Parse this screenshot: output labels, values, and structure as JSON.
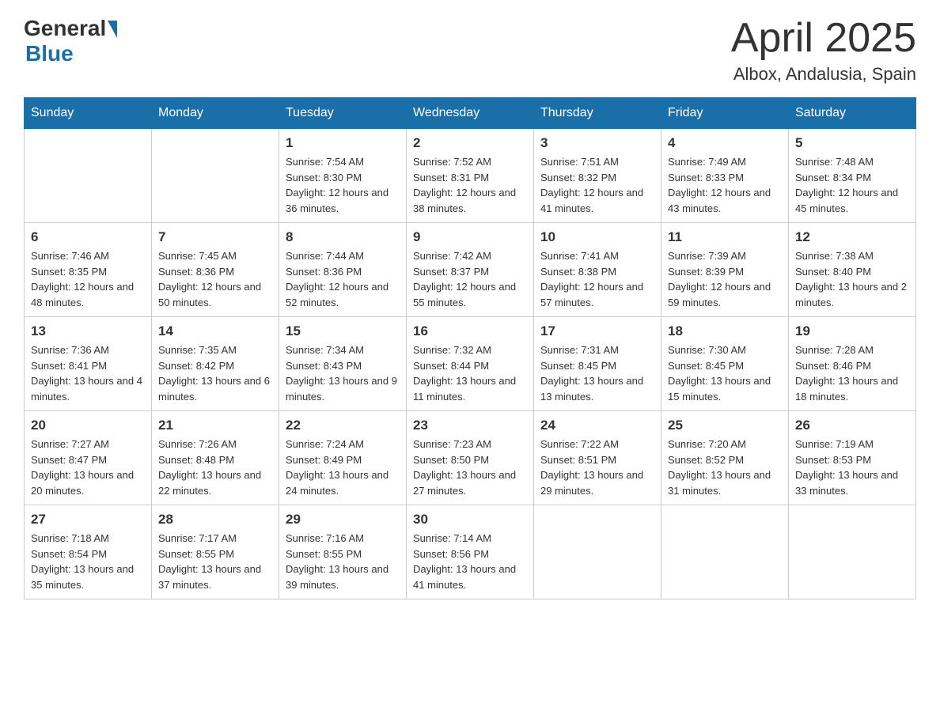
{
  "header": {
    "logo_general": "General",
    "logo_blue": "Blue",
    "title": "April 2025",
    "subtitle": "Albox, Andalusia, Spain"
  },
  "calendar": {
    "days_of_week": [
      "Sunday",
      "Monday",
      "Tuesday",
      "Wednesday",
      "Thursday",
      "Friday",
      "Saturday"
    ],
    "weeks": [
      [
        {
          "day": "",
          "sunrise": "",
          "sunset": "",
          "daylight": ""
        },
        {
          "day": "",
          "sunrise": "",
          "sunset": "",
          "daylight": ""
        },
        {
          "day": "1",
          "sunrise": "Sunrise: 7:54 AM",
          "sunset": "Sunset: 8:30 PM",
          "daylight": "Daylight: 12 hours and 36 minutes."
        },
        {
          "day": "2",
          "sunrise": "Sunrise: 7:52 AM",
          "sunset": "Sunset: 8:31 PM",
          "daylight": "Daylight: 12 hours and 38 minutes."
        },
        {
          "day": "3",
          "sunrise": "Sunrise: 7:51 AM",
          "sunset": "Sunset: 8:32 PM",
          "daylight": "Daylight: 12 hours and 41 minutes."
        },
        {
          "day": "4",
          "sunrise": "Sunrise: 7:49 AM",
          "sunset": "Sunset: 8:33 PM",
          "daylight": "Daylight: 12 hours and 43 minutes."
        },
        {
          "day": "5",
          "sunrise": "Sunrise: 7:48 AM",
          "sunset": "Sunset: 8:34 PM",
          "daylight": "Daylight: 12 hours and 45 minutes."
        }
      ],
      [
        {
          "day": "6",
          "sunrise": "Sunrise: 7:46 AM",
          "sunset": "Sunset: 8:35 PM",
          "daylight": "Daylight: 12 hours and 48 minutes."
        },
        {
          "day": "7",
          "sunrise": "Sunrise: 7:45 AM",
          "sunset": "Sunset: 8:36 PM",
          "daylight": "Daylight: 12 hours and 50 minutes."
        },
        {
          "day": "8",
          "sunrise": "Sunrise: 7:44 AM",
          "sunset": "Sunset: 8:36 PM",
          "daylight": "Daylight: 12 hours and 52 minutes."
        },
        {
          "day": "9",
          "sunrise": "Sunrise: 7:42 AM",
          "sunset": "Sunset: 8:37 PM",
          "daylight": "Daylight: 12 hours and 55 minutes."
        },
        {
          "day": "10",
          "sunrise": "Sunrise: 7:41 AM",
          "sunset": "Sunset: 8:38 PM",
          "daylight": "Daylight: 12 hours and 57 minutes."
        },
        {
          "day": "11",
          "sunrise": "Sunrise: 7:39 AM",
          "sunset": "Sunset: 8:39 PM",
          "daylight": "Daylight: 12 hours and 59 minutes."
        },
        {
          "day": "12",
          "sunrise": "Sunrise: 7:38 AM",
          "sunset": "Sunset: 8:40 PM",
          "daylight": "Daylight: 13 hours and 2 minutes."
        }
      ],
      [
        {
          "day": "13",
          "sunrise": "Sunrise: 7:36 AM",
          "sunset": "Sunset: 8:41 PM",
          "daylight": "Daylight: 13 hours and 4 minutes."
        },
        {
          "day": "14",
          "sunrise": "Sunrise: 7:35 AM",
          "sunset": "Sunset: 8:42 PM",
          "daylight": "Daylight: 13 hours and 6 minutes."
        },
        {
          "day": "15",
          "sunrise": "Sunrise: 7:34 AM",
          "sunset": "Sunset: 8:43 PM",
          "daylight": "Daylight: 13 hours and 9 minutes."
        },
        {
          "day": "16",
          "sunrise": "Sunrise: 7:32 AM",
          "sunset": "Sunset: 8:44 PM",
          "daylight": "Daylight: 13 hours and 11 minutes."
        },
        {
          "day": "17",
          "sunrise": "Sunrise: 7:31 AM",
          "sunset": "Sunset: 8:45 PM",
          "daylight": "Daylight: 13 hours and 13 minutes."
        },
        {
          "day": "18",
          "sunrise": "Sunrise: 7:30 AM",
          "sunset": "Sunset: 8:45 PM",
          "daylight": "Daylight: 13 hours and 15 minutes."
        },
        {
          "day": "19",
          "sunrise": "Sunrise: 7:28 AM",
          "sunset": "Sunset: 8:46 PM",
          "daylight": "Daylight: 13 hours and 18 minutes."
        }
      ],
      [
        {
          "day": "20",
          "sunrise": "Sunrise: 7:27 AM",
          "sunset": "Sunset: 8:47 PM",
          "daylight": "Daylight: 13 hours and 20 minutes."
        },
        {
          "day": "21",
          "sunrise": "Sunrise: 7:26 AM",
          "sunset": "Sunset: 8:48 PM",
          "daylight": "Daylight: 13 hours and 22 minutes."
        },
        {
          "day": "22",
          "sunrise": "Sunrise: 7:24 AM",
          "sunset": "Sunset: 8:49 PM",
          "daylight": "Daylight: 13 hours and 24 minutes."
        },
        {
          "day": "23",
          "sunrise": "Sunrise: 7:23 AM",
          "sunset": "Sunset: 8:50 PM",
          "daylight": "Daylight: 13 hours and 27 minutes."
        },
        {
          "day": "24",
          "sunrise": "Sunrise: 7:22 AM",
          "sunset": "Sunset: 8:51 PM",
          "daylight": "Daylight: 13 hours and 29 minutes."
        },
        {
          "day": "25",
          "sunrise": "Sunrise: 7:20 AM",
          "sunset": "Sunset: 8:52 PM",
          "daylight": "Daylight: 13 hours and 31 minutes."
        },
        {
          "day": "26",
          "sunrise": "Sunrise: 7:19 AM",
          "sunset": "Sunset: 8:53 PM",
          "daylight": "Daylight: 13 hours and 33 minutes."
        }
      ],
      [
        {
          "day": "27",
          "sunrise": "Sunrise: 7:18 AM",
          "sunset": "Sunset: 8:54 PM",
          "daylight": "Daylight: 13 hours and 35 minutes."
        },
        {
          "day": "28",
          "sunrise": "Sunrise: 7:17 AM",
          "sunset": "Sunset: 8:55 PM",
          "daylight": "Daylight: 13 hours and 37 minutes."
        },
        {
          "day": "29",
          "sunrise": "Sunrise: 7:16 AM",
          "sunset": "Sunset: 8:55 PM",
          "daylight": "Daylight: 13 hours and 39 minutes."
        },
        {
          "day": "30",
          "sunrise": "Sunrise: 7:14 AM",
          "sunset": "Sunset: 8:56 PM",
          "daylight": "Daylight: 13 hours and 41 minutes."
        },
        {
          "day": "",
          "sunrise": "",
          "sunset": "",
          "daylight": ""
        },
        {
          "day": "",
          "sunrise": "",
          "sunset": "",
          "daylight": ""
        },
        {
          "day": "",
          "sunrise": "",
          "sunset": "",
          "daylight": ""
        }
      ]
    ]
  }
}
